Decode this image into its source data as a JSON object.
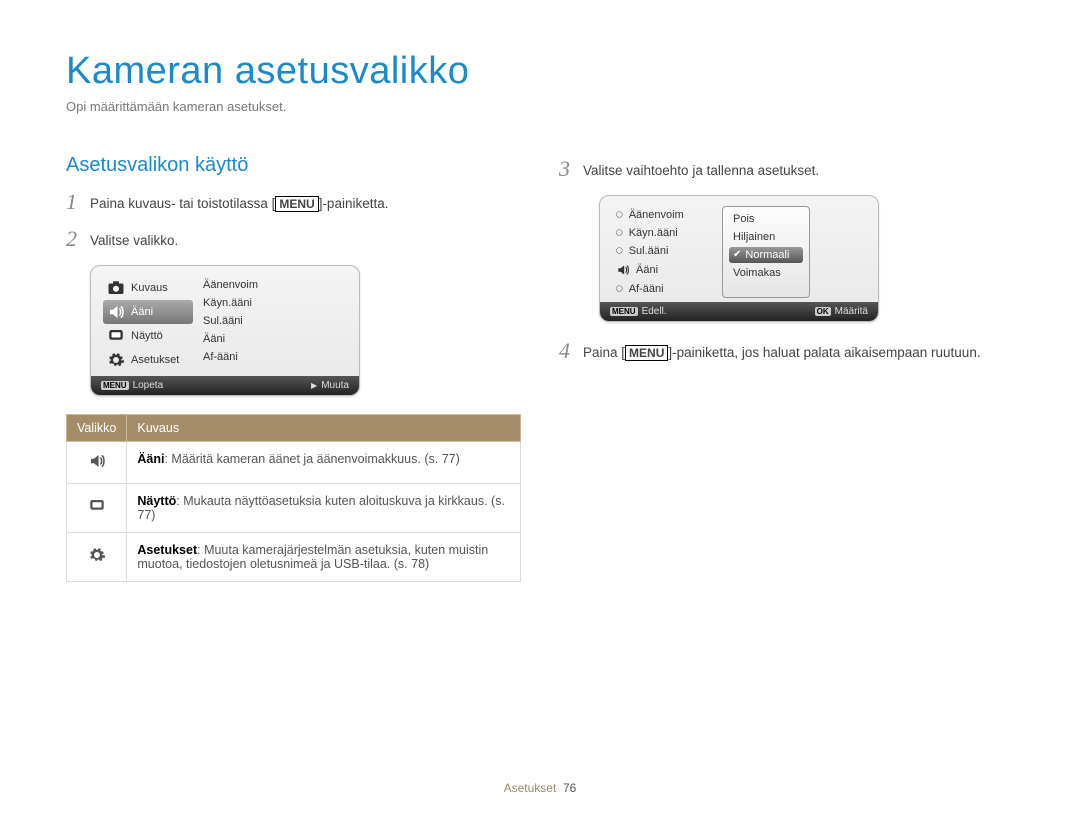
{
  "title": "Kameran asetusvalikko",
  "subtitle": "Opi määrittämään kameran asetukset.",
  "section_heading": "Asetusvalikon käyttö",
  "menu_label": "MENU",
  "steps": {
    "s1_pre": "Paina kuvaus- tai toistotilassa [",
    "s1_post": "]-painiketta.",
    "s2": "Valitse valikko.",
    "s3": "Valitse vaihtoehto ja tallenna asetukset.",
    "s4_pre": "Paina [",
    "s4_post": "]-painiketta, jos haluat palata aikaisempaan ruutuun."
  },
  "screen1": {
    "left": [
      "Kuvaus",
      "Ääni",
      "Näyttö",
      "Asetukset"
    ],
    "right": [
      "Äänenvoim",
      "Käyn.ääni",
      "Sul.ääni",
      "Ääni",
      "Af-ääni"
    ],
    "foot_left_key": "MENU",
    "foot_left": "Lopeta",
    "foot_right_tri": "▶",
    "foot_right": "Muuta"
  },
  "screen2": {
    "left": [
      "Äänenvoim",
      "Käyn.ääni",
      "Sul.ääni",
      "Ääni",
      "Af-ääni"
    ],
    "values": [
      "Pois",
      "Hiljainen",
      "Normaali",
      "Voimakas"
    ],
    "selected_value_index": 2,
    "foot_left_key": "MENU",
    "foot_left": "Edell.",
    "foot_right_key": "OK",
    "foot_right": "Määritä"
  },
  "table": {
    "head_menu": "Valikko",
    "head_desc": "Kuvaus",
    "rows": [
      {
        "bold": "Ääni",
        "rest": ": Määritä kameran äänet ja äänenvoimakkuus. (s. 77)"
      },
      {
        "bold": "Näyttö",
        "rest": ": Mukauta näyttöasetuksia kuten aloituskuva ja kirkkaus. (s. 77)"
      },
      {
        "bold": "Asetukset",
        "rest": ": Muuta kamerajärjestelmän asetuksia, kuten muistin muotoa, tiedostojen oletusnimeä ja USB-tilaa. (s. 78)"
      }
    ]
  },
  "footer_section": "Asetukset",
  "footer_page": "76"
}
